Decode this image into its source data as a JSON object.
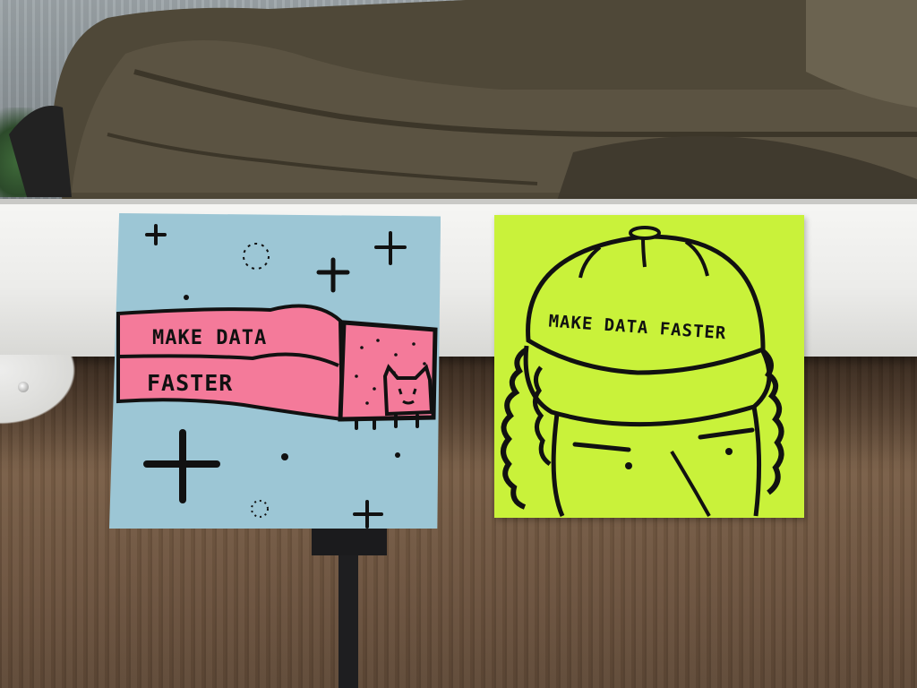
{
  "notes": {
    "blue": {
      "line1": "MAKE DATA",
      "line2": "FASTER",
      "color": "#9cc6d5",
      "banner_color": "#f47a9a"
    },
    "green": {
      "hat_text": "MAKE DATA FASTER",
      "color": "#c9f23a"
    }
  },
  "scene": {
    "wall_color": "#6c533e",
    "shelf_color": "#efefed",
    "fabric_color": "#4d4636"
  }
}
